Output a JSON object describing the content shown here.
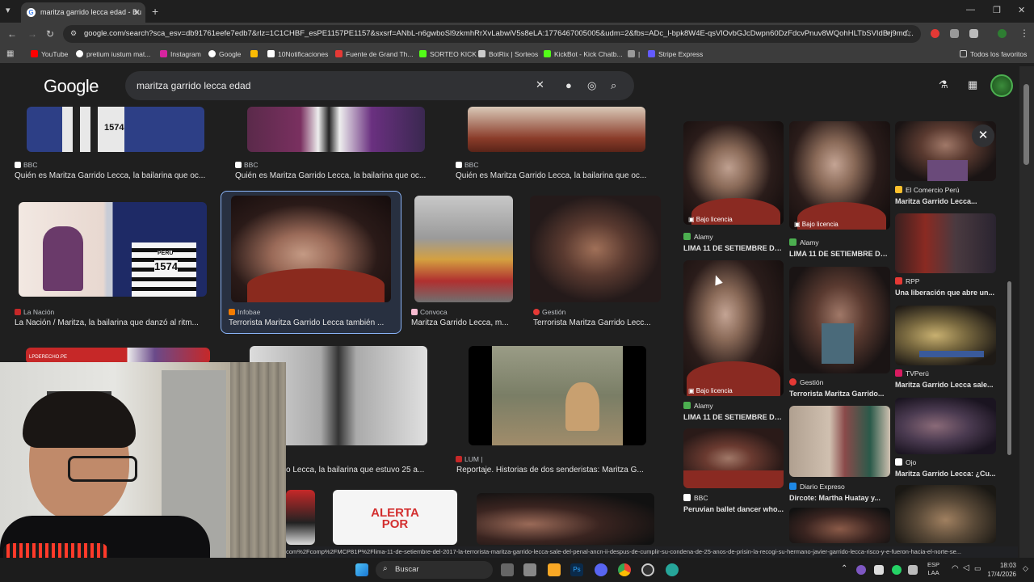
{
  "browser": {
    "tab_title": "maritza garrido lecca edad - Bu",
    "tab_favicon": "G",
    "url": "google.com/search?sca_esv=db91761eefe7edb7&rlz=1C1CHBF_esPE1157PE1157&sxsrf=ANbL-n6gwboSl9zkmhRrXvLabwiV5s8eLA:1776467005005&udm=2&fbs=ADc_l-bpk8W4E-qsVlOvbGJcDwpn60DzFdcvPnuv8WQohHLTbSVIdBrj9md...",
    "bookmarks": [
      "YouTube",
      "pretium iustum mat...",
      "Instagram",
      "Google",
      "",
      "10Notificaciones",
      "Fuente de Grand Th...",
      "SORTEO KICK",
      "BotRix | Sorteos",
      "KickBot - Kick Chatb...",
      "|",
      "Stripe Express"
    ],
    "all_favorites": "Todos los favoritos"
  },
  "google": {
    "logo": "Google",
    "query": "maritza garrido lecca edad"
  },
  "results": {
    "row1": [
      {
        "source": "BBC",
        "caption": "Quién es Maritza Garrido Lecca, la bailarina que oc..."
      },
      {
        "source": "BBC",
        "caption": "Quién es Maritza Garrido Lecca, la bailarina que oc..."
      },
      {
        "source": "BBC",
        "caption": "Quién es Maritza Garrido Lecca, la bailarina que oc..."
      }
    ],
    "row2": [
      {
        "source": "La Nación",
        "caption": "La Nación / Maritza, la bailarina que danzó al ritm..."
      },
      {
        "source": "Infobae",
        "caption": "Terrorista Maritza Garrido Lecca también ..."
      },
      {
        "source": "Convoca",
        "caption": "Maritza Garrido Lecca, m..."
      },
      {
        "source": "Gestión",
        "caption": "Terrorista Maritza Garrido Lecc..."
      }
    ],
    "row3": [
      {
        "source": "",
        "caption": "o Lecca, la bailarina que estuvo 25 a..."
      },
      {
        "source": "LUM |",
        "caption": "Reportaje. Historias de dos senderistas: Maritza G..."
      }
    ],
    "labels": {
      "pe_1574": "1574",
      "peru": "PERU",
      "alerta": "ALERTA POR",
      "lpderecho": "LPDERECHO.PE"
    }
  },
  "panel": {
    "license_label": "Bajo licencia",
    "items": [
      {
        "source": "Alamy",
        "caption": "LIMA 11 DE SETIEMBRE DEL..."
      },
      {
        "source": "Alamy",
        "caption": "LIMA 11 DE SETIEMBRE DEL..."
      },
      {
        "source": "El Comercio Perú",
        "caption": "Maritza Garrido Lecca..."
      },
      {
        "source": "RPP",
        "caption": "Una liberación que abre un..."
      },
      {
        "source": "Alamy",
        "caption": "LIMA 11 DE SETIEMBRE DEL..."
      },
      {
        "source": "Gestión",
        "caption": "Terrorista Maritza Garrido..."
      },
      {
        "source": "TVPerú",
        "caption": "Maritza Garrido Lecca sale..."
      },
      {
        "source": "BBC",
        "caption": "Peruvian ballet dancer who..."
      },
      {
        "source": "Diario Expreso",
        "caption": "Dircote: Martha Huatay y..."
      },
      {
        "source": "Ojo",
        "caption": "Maritza Garrido Lecca: ¿Cu..."
      }
    ]
  },
  "status_url": "com%2Fcomp%2FMCP81P%2Flima-11-de-setiembre-del-2017-la-terrorista-maritza-garrido-lecca-sale-del-penal-ancn-ii-despus-de-cumplir-su-condena-de-25-anos-de-prisin-la-recogi-su-hermano-javier-garrido-lecca-risco-y-e-fueron-hacia-el-norte-se...",
  "taskbar": {
    "search": "Buscar",
    "lang": "ESP",
    "lang2": "LAA",
    "time": "18:03",
    "date": "17/4/2026"
  }
}
